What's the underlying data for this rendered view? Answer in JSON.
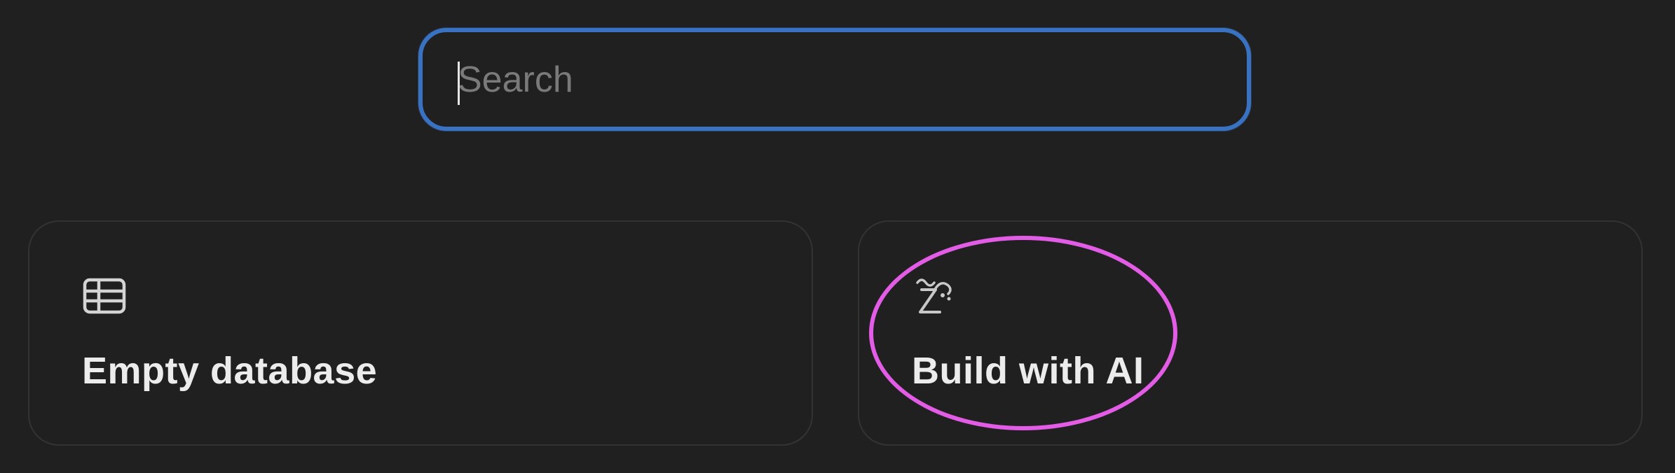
{
  "search": {
    "placeholder": "Search",
    "value": ""
  },
  "options": [
    {
      "label": "Empty database",
      "icon": "table-icon"
    },
    {
      "label": "Build with AI",
      "icon": "ai-sparkle-icon"
    }
  ],
  "colors": {
    "background": "#202020",
    "search_focus_border": "#3a72c2",
    "card_border": "#333333",
    "text": "#ececec",
    "placeholder": "#7a7a7a",
    "highlight_annotation": "#e25ce6"
  }
}
